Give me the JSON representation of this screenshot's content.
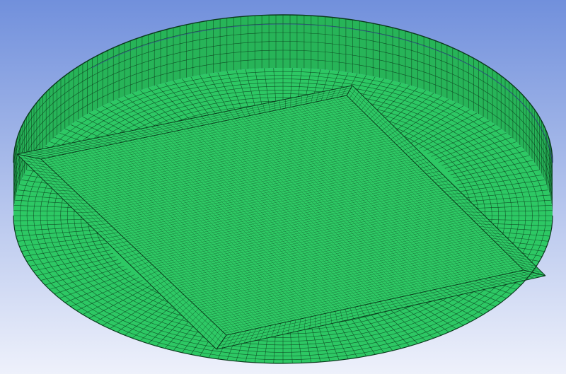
{
  "viewport": {
    "background_top_color": "#7190dc",
    "background_bottom_color": "#eef1fb",
    "mesh_fill_color": "#2dc864",
    "mesh_side_color": "#27b458",
    "mesh_line_color": "#0a3a1c",
    "edge_highlight_color": "#3a3aa0"
  },
  "model": {
    "shape": "circular disk with square pocket",
    "display_mode": "mesh",
    "icon": "mesh-model-icon"
  }
}
